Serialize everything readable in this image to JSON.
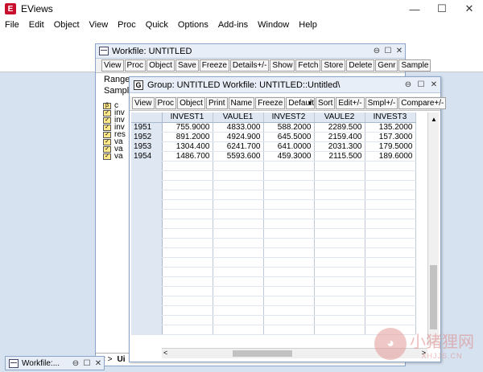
{
  "app": {
    "title": "EViews",
    "icon_letter": "E"
  },
  "menu": [
    "File",
    "Edit",
    "Object",
    "View",
    "Proc",
    "Quick",
    "Options",
    "Add-ins",
    "Window",
    "Help"
  ],
  "window_controls": [
    "—",
    "☐",
    "✕"
  ],
  "workfile": {
    "title": "Workfile: UNTITLED",
    "controls": [
      "⊖",
      "☐",
      "✕"
    ],
    "toolbar": [
      "View",
      "Proc",
      "Object",
      "Save",
      "Freeze",
      "Details+/-",
      "Show",
      "Fetch",
      "Store",
      "Delete",
      "Genr",
      "Sample"
    ],
    "range_label": "Range",
    "sample_label": "Sampl",
    "objects": [
      {
        "icon": "β",
        "name": "c"
      },
      {
        "icon": "✓",
        "name": "inv"
      },
      {
        "icon": "✓",
        "name": "inv"
      },
      {
        "icon": "✓",
        "name": "inv"
      },
      {
        "icon": "✓",
        "name": "res"
      },
      {
        "icon": "✓",
        "name": "va"
      },
      {
        "icon": "✓",
        "name": "va"
      },
      {
        "icon": "✓",
        "name": "va"
      }
    ],
    "tab_nav": "< >",
    "tab_label": "Ui"
  },
  "group": {
    "icon_letter": "G",
    "title": "Group: UNTITLED   Workfile: UNTITLED::Untitled\\",
    "controls": [
      "⊖",
      "☐",
      "✕"
    ],
    "toolbar_left": [
      "View",
      "Proc",
      "Object",
      "Print",
      "Name",
      "Freeze"
    ],
    "view_select": "Default",
    "toolbar_right": [
      "Sort",
      "Edit+/-",
      "Smpl+/-",
      "Compare+/-"
    ],
    "columns": [
      "INVEST1",
      "VAULE1",
      "INVEST2",
      "VAULE2",
      "INVEST3"
    ],
    "rows": [
      {
        "obs": "1951",
        "values": [
          "755.9000",
          "4833.000",
          "588.2000",
          "2289.500",
          "135.2000"
        ]
      },
      {
        "obs": "1952",
        "values": [
          "891.2000",
          "4924.900",
          "645.5000",
          "2159.400",
          "157.3000"
        ]
      },
      {
        "obs": "1953",
        "values": [
          "1304.400",
          "6241.700",
          "641.0000",
          "2031.300",
          "179.5000"
        ]
      },
      {
        "obs": "1954",
        "values": [
          "1486.700",
          "5593.600",
          "459.3000",
          "2115.500",
          "189.6000"
        ]
      }
    ]
  },
  "minimized": {
    "title": "Workfile:...",
    "controls": [
      "⊖",
      "☐",
      "✕"
    ]
  },
  "watermark": {
    "text": "小猪狸网",
    "sub": "XHJJS.CN"
  }
}
